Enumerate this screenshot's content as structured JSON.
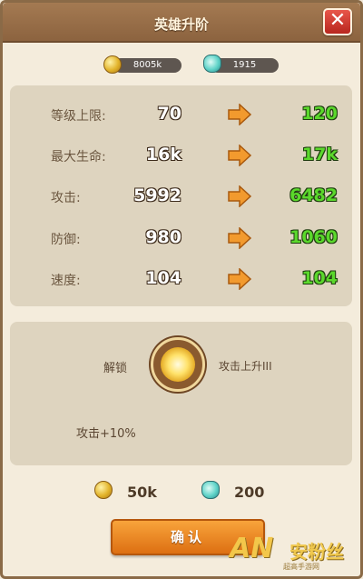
{
  "header": {
    "title": "英雄升阶",
    "close_label": "✕"
  },
  "resources": {
    "coins": "8005k",
    "gems": "1915"
  },
  "stats": [
    {
      "label": "等级上限:",
      "current": "70",
      "next": "120"
    },
    {
      "label": "最大生命:",
      "current": "16k",
      "next": "17k"
    },
    {
      "label": "攻击:",
      "current": "5992",
      "next": "6482"
    },
    {
      "label": "防御:",
      "current": "980",
      "next": "1060"
    },
    {
      "label": "速度:",
      "current": "104",
      "next": "104"
    }
  ],
  "unlock": {
    "label": "解锁",
    "skill": "攻击上升III",
    "bonus": "攻击+10%"
  },
  "cost": {
    "coins": "50k",
    "gems": "200"
  },
  "confirm_label": "确认",
  "watermark": {
    "logo": "AN",
    "text": "安粉丝",
    "sub": "超高手游网"
  },
  "colors": {
    "accent": "#f29a2e",
    "next_value": "#5bd82c",
    "header": "#9a6f48"
  }
}
